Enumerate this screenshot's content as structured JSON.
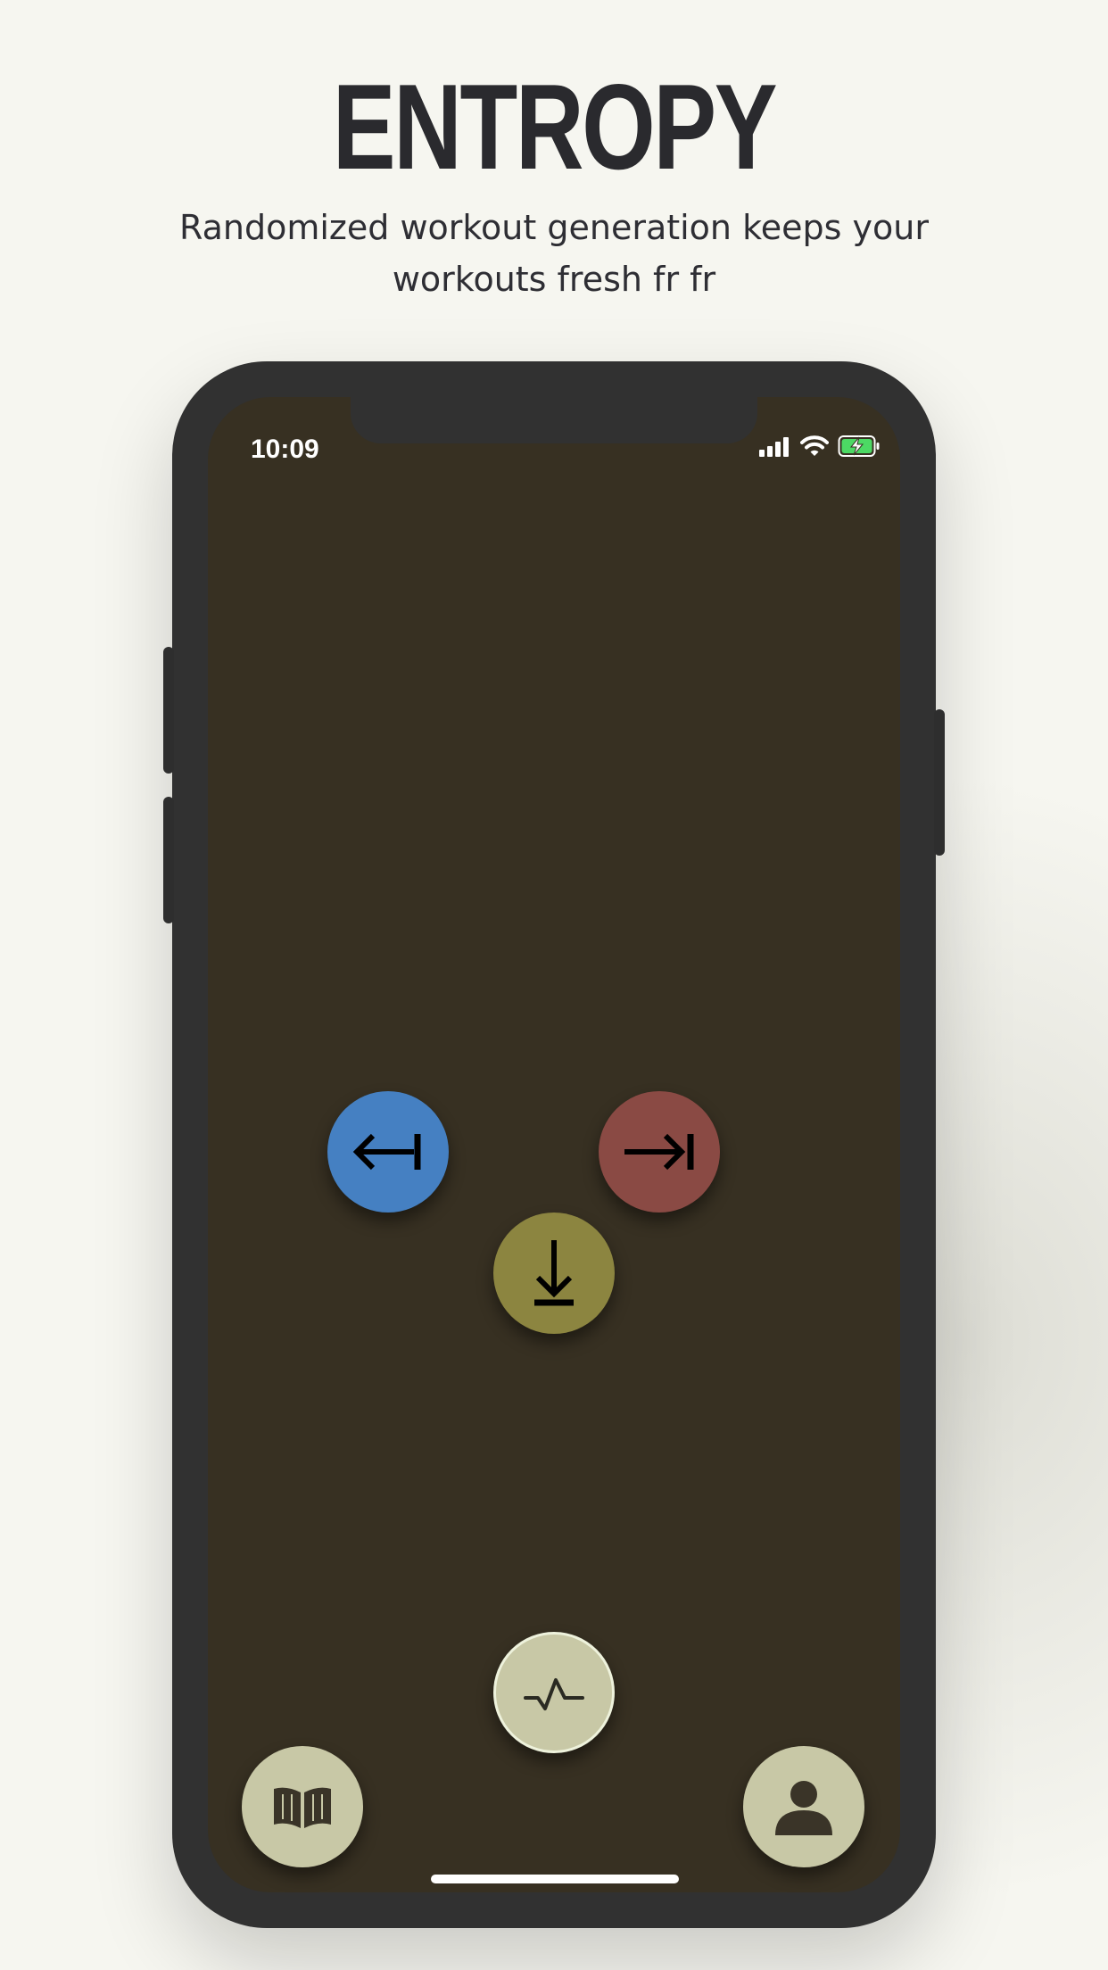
{
  "header": {
    "title": "ENTROPY",
    "subtitle": "Randomized workout generation keeps your workouts fresh fr fr"
  },
  "status_bar": {
    "time": "10:09",
    "icons": [
      "cellular-signal-icon",
      "wifi-icon",
      "battery-charging-icon"
    ]
  },
  "controls": {
    "left": {
      "icon": "arrow-left-to-bar-icon",
      "color": "#4580c2"
    },
    "right": {
      "icon": "arrow-right-to-bar-icon",
      "color": "#8a4a44"
    },
    "down": {
      "icon": "arrow-down-to-bar-icon",
      "color": "#8c8540"
    }
  },
  "nav": {
    "activity": {
      "icon": "activity-pulse-icon",
      "color": "#c8c8a6"
    },
    "library": {
      "icon": "open-book-icon",
      "color": "#c8c8a6"
    },
    "profile": {
      "icon": "user-icon",
      "color": "#c8c8a6"
    }
  },
  "colors": {
    "page_bg": "#f6f6f0",
    "phone_frame": "#313131",
    "screen_bg": "#373022",
    "battery_green": "#4cd964"
  }
}
